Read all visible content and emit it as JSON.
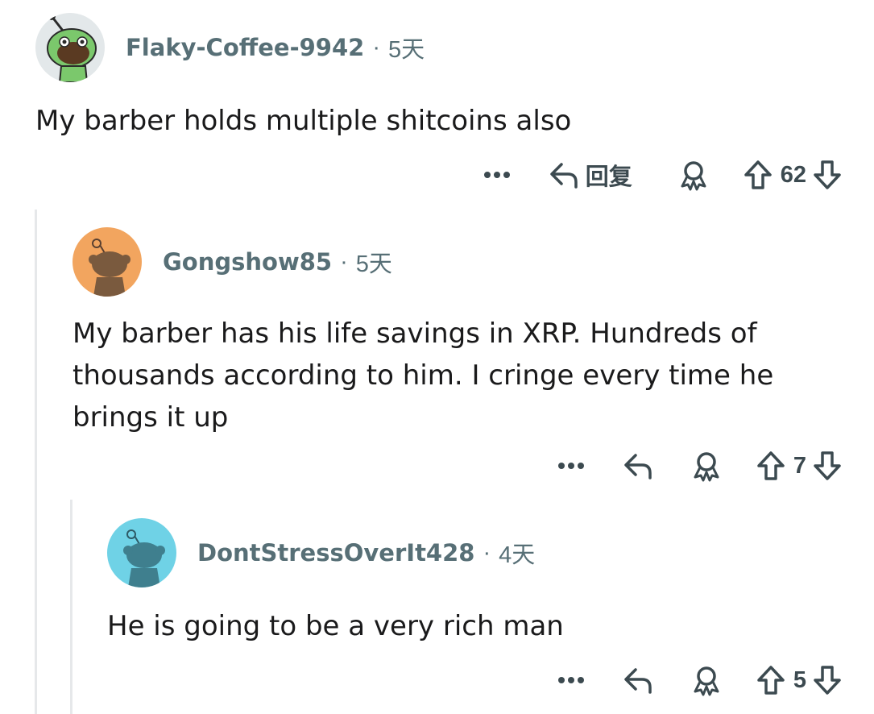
{
  "comments": [
    {
      "username": "Flaky-Coffee-9942",
      "age": "5天",
      "body": "My barber holds multiple shitcoins also",
      "reply_label": "回复",
      "votes": "62",
      "avatar_color": "#e3e8ea"
    },
    {
      "username": "Gongshow85",
      "age": "5天",
      "body": "My barber has his life savings in XRP. Hundreds of thousands according to him. I cringe every time he brings it up",
      "votes": "7",
      "avatar_color": "#f2a55f"
    },
    {
      "username": "DontStressOverIt428",
      "age": "4天",
      "body": "He is going to be a very rich man",
      "votes": "5",
      "avatar_color": "#6fd2e6"
    }
  ],
  "separator": "·",
  "more_label": "···",
  "icons": [
    "more-icon",
    "reply-icon",
    "award-icon",
    "upvote-icon",
    "downvote-icon"
  ],
  "colors": {
    "meta": "#576f76",
    "text": "#1a1a1b",
    "thread_line": "#e6e8ea"
  }
}
